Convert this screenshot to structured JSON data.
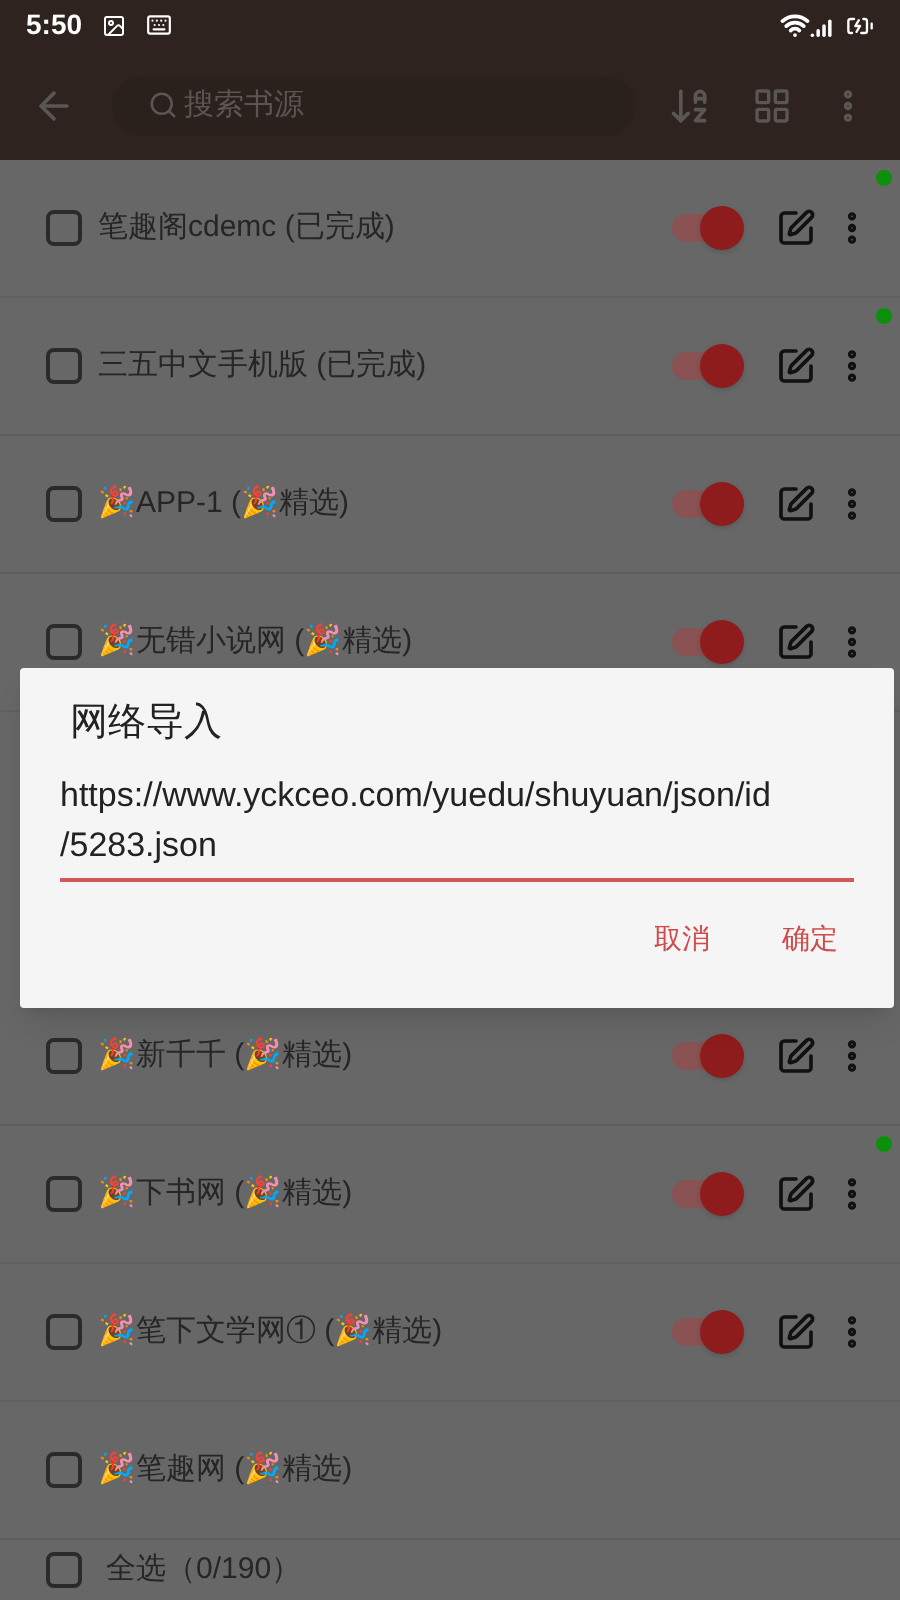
{
  "status_bar": {
    "time": "5:50"
  },
  "toolbar": {
    "search": {
      "placeholder": "搜索书源"
    }
  },
  "sources": [
    {
      "name": "笔趣阁cdemc (已完成)",
      "checked": false,
      "on": true,
      "status_dot": true
    },
    {
      "name": "三五中文手机版 (已完成)",
      "checked": false,
      "on": true,
      "status_dot": true
    },
    {
      "name": "🎉APP-1 (🎉精选)",
      "checked": false,
      "on": true,
      "status_dot": false
    },
    {
      "name": "🎉无错小说网 (🎉精选)",
      "checked": false,
      "on": true,
      "status_dot": false
    },
    {
      "name": "🎉新千千 (🎉精选)",
      "checked": false,
      "on": true,
      "status_dot": false
    },
    {
      "name": "🎉下书网 (🎉精选)",
      "checked": false,
      "on": true,
      "status_dot": true
    },
    {
      "name": "🎉笔下文学网① (🎉精选)",
      "checked": false,
      "on": true,
      "status_dot": false
    },
    {
      "name": "🎉笔趣网 (🎉精选)",
      "checked": false,
      "status_dot": false
    }
  ],
  "footer": {
    "select_all": {
      "label": "全选（0/190）",
      "checked": false
    }
  },
  "dialog": {
    "title": "网络导入",
    "value": "https://www.yckceo.com/yuedu/shuyuan/json/id/5283.json",
    "buttons": [
      "取消",
      "确定"
    ]
  }
}
